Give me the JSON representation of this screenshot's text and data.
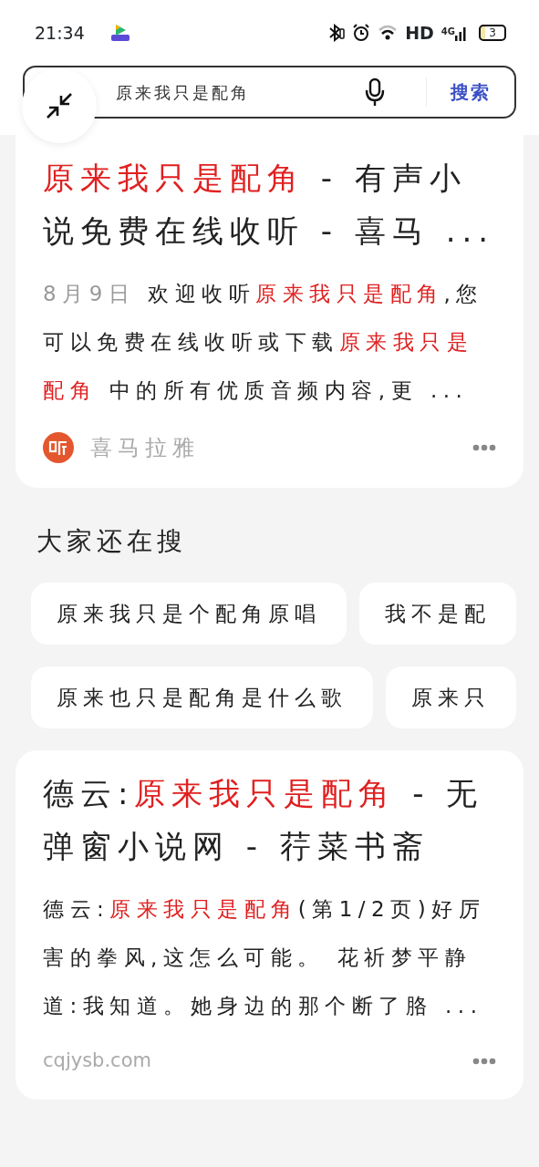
{
  "status_bar": {
    "time": "21:34",
    "network_label": "HD",
    "signal_label": "4G",
    "battery": "3"
  },
  "search": {
    "query": "原来我只是配角",
    "button": "搜索"
  },
  "results": [
    {
      "title": [
        {
          "text": "原来我只是配角",
          "highlight": true
        },
        {
          "text": " - 有声小说免费在线收听 - 喜马 ...",
          "highlight": false
        }
      ],
      "date": "8月9日",
      "snippet": [
        {
          "text": "欢迎收听",
          "highlight": false
        },
        {
          "text": "原来我只是配角",
          "highlight": true
        },
        {
          "text": ",您可以免费在线收听或下载",
          "highlight": false
        },
        {
          "text": "原来我只是配角",
          "highlight": true
        },
        {
          "text": " 中的所有优质音频内容,更 ...",
          "highlight": false
        }
      ],
      "source": "喜马拉雅",
      "kind": "with_logo"
    },
    {
      "kind": "related",
      "heading": "大家还在搜",
      "rows": [
        [
          "原来我只是个配角原唱",
          "我不是配"
        ],
        [
          "原来也只是配角是什么歌",
          "原来只"
        ]
      ]
    },
    {
      "title": [
        {
          "text": "德云:",
          "highlight": false
        },
        {
          "text": "原来我只是配角",
          "highlight": true
        },
        {
          "text": " - 无弹窗小说网 - 荇菜书斋",
          "highlight": false
        }
      ],
      "snippet": [
        {
          "text": "德云:",
          "highlight": false
        },
        {
          "text": "原来我只是配角",
          "highlight": true
        },
        {
          "text": "(第1/2页)好厉害的拳风,这怎么可能。 花祈梦平静道:我知道。她身边的那个断了胳 ...",
          "highlight": false
        }
      ],
      "source": "cqjysb.com",
      "kind": "plain"
    }
  ]
}
